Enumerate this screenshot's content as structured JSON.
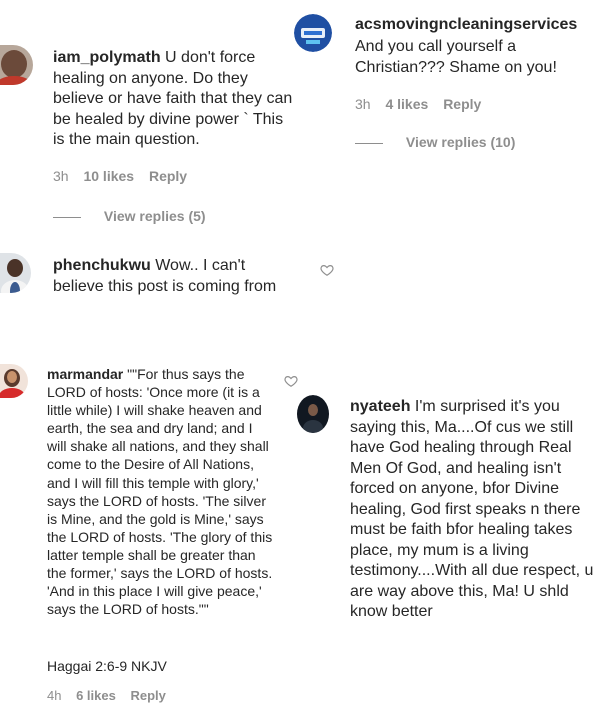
{
  "comments": [
    {
      "username": "iam_polymath",
      "text": "U don't force healing on anyone. Do they believe or have faith that they can be healed by divine power ` This is the main question.",
      "time": "3h",
      "likes": "10 likes",
      "reply": "Reply",
      "view_replies": "View replies (5)"
    },
    {
      "username": "acsmovingncleaningservices",
      "text": "And you call yourself a Christian??? Shame on you!",
      "time": "3h",
      "likes": "4 likes",
      "reply": "Reply",
      "view_replies": "View replies (10)"
    },
    {
      "username": "phenchukwu",
      "text": "Wow.. I can't believe this post is coming from"
    },
    {
      "username": "marmandar",
      "text": "\"\"For thus says the LORD of hosts: 'Once more (it is a little while) I will shake heaven and earth, the sea and dry land; and I will shake all nations, and they shall come to the Desire of All Nations, and I will fill this temple with glory,' says the LORD of hosts. 'The silver is Mine, and the gold is Mine,' says the LORD of hosts. 'The glory of this latter temple shall be greater than the former,' says the LORD of hosts. 'And in this place I will give peace,' says the LORD of hosts.\"\"",
      "reference": "Haggai 2:6-9 NKJV",
      "time": "4h",
      "likes": "6 likes",
      "reply": "Reply"
    },
    {
      "username": "nyateeh",
      "text": "I'm surprised it's you saying this, Ma....Of cus we still have God healing through Real Men Of God, and healing isn't forced on anyone, bfor Divine healing, God first speaks n there must be faith bfor healing takes place, my mum is a living testimony....With all due respect, u are way above this, Ma! U shld know better"
    }
  ],
  "icons": {
    "like": "heart-outline-icon"
  },
  "colors": {
    "text": "#262626",
    "meta": "#8e8e8e",
    "background": "#ffffff"
  }
}
